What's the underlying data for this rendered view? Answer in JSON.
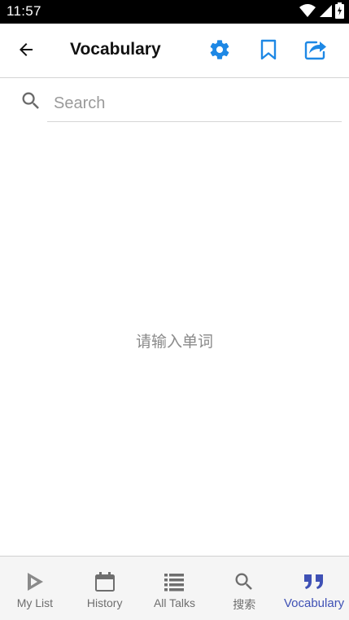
{
  "status_bar": {
    "time": "11:57",
    "icons": [
      "wifi-icon",
      "signal-icon",
      "battery-charging-icon"
    ]
  },
  "app_bar": {
    "back_icon": "arrow-back-icon",
    "title": "Vocabulary",
    "actions": [
      "settings-icon",
      "bookmark-icon",
      "share-icon"
    ],
    "accent_color": "#1e88e5"
  },
  "search": {
    "placeholder": "Search",
    "value": ""
  },
  "empty_state": {
    "text": "请输入单词"
  },
  "bottom_nav": {
    "active_color": "#3f51b5",
    "items": [
      {
        "label": "My List",
        "icon": "play-triangle-icon",
        "active": false
      },
      {
        "label": "History",
        "icon": "calendar-icon",
        "active": false
      },
      {
        "label": "All Talks",
        "icon": "list-icon",
        "active": false
      },
      {
        "label": "搜索",
        "icon": "search-icon",
        "active": false
      },
      {
        "label": "Vocabulary",
        "icon": "quote-icon",
        "active": true
      }
    ]
  }
}
